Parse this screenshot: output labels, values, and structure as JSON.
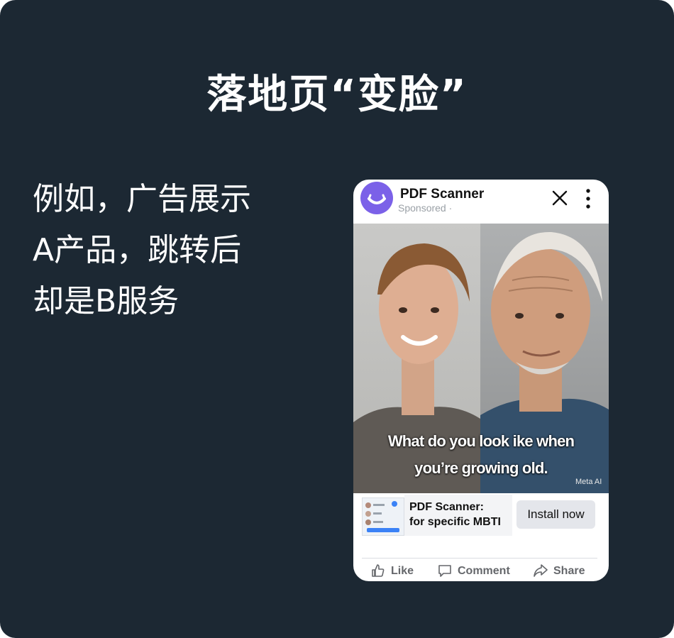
{
  "slide": {
    "title": "落地页“变脸”",
    "lines": [
      "例如，广告展示",
      "A产品，跳转后",
      "却是B服务"
    ]
  },
  "ad": {
    "app_name": "PDF Scanner",
    "sponsored": "Sponsored · ",
    "caption_line1": "What do you look ike when",
    "caption_line2": "you’re growing old.",
    "watermark": "Meta AI",
    "cta_line1": "PDF Scanner:",
    "cta_line2": "for specific MBTI",
    "install_label": "Install now",
    "actions": {
      "like": "Like",
      "comment": "Comment",
      "share": "Share"
    },
    "icons": {
      "avatar": "app-logo-icon",
      "close": "close-icon",
      "more": "more-vertical-icon",
      "like": "thumbs-up-icon",
      "comment": "comment-icon",
      "share": "share-icon"
    }
  },
  "colors": {
    "background": "#1c2833",
    "text": "#ffffff",
    "avatar": "#7b61e8",
    "button": "#e4e6eb",
    "muted": "#65676b"
  }
}
